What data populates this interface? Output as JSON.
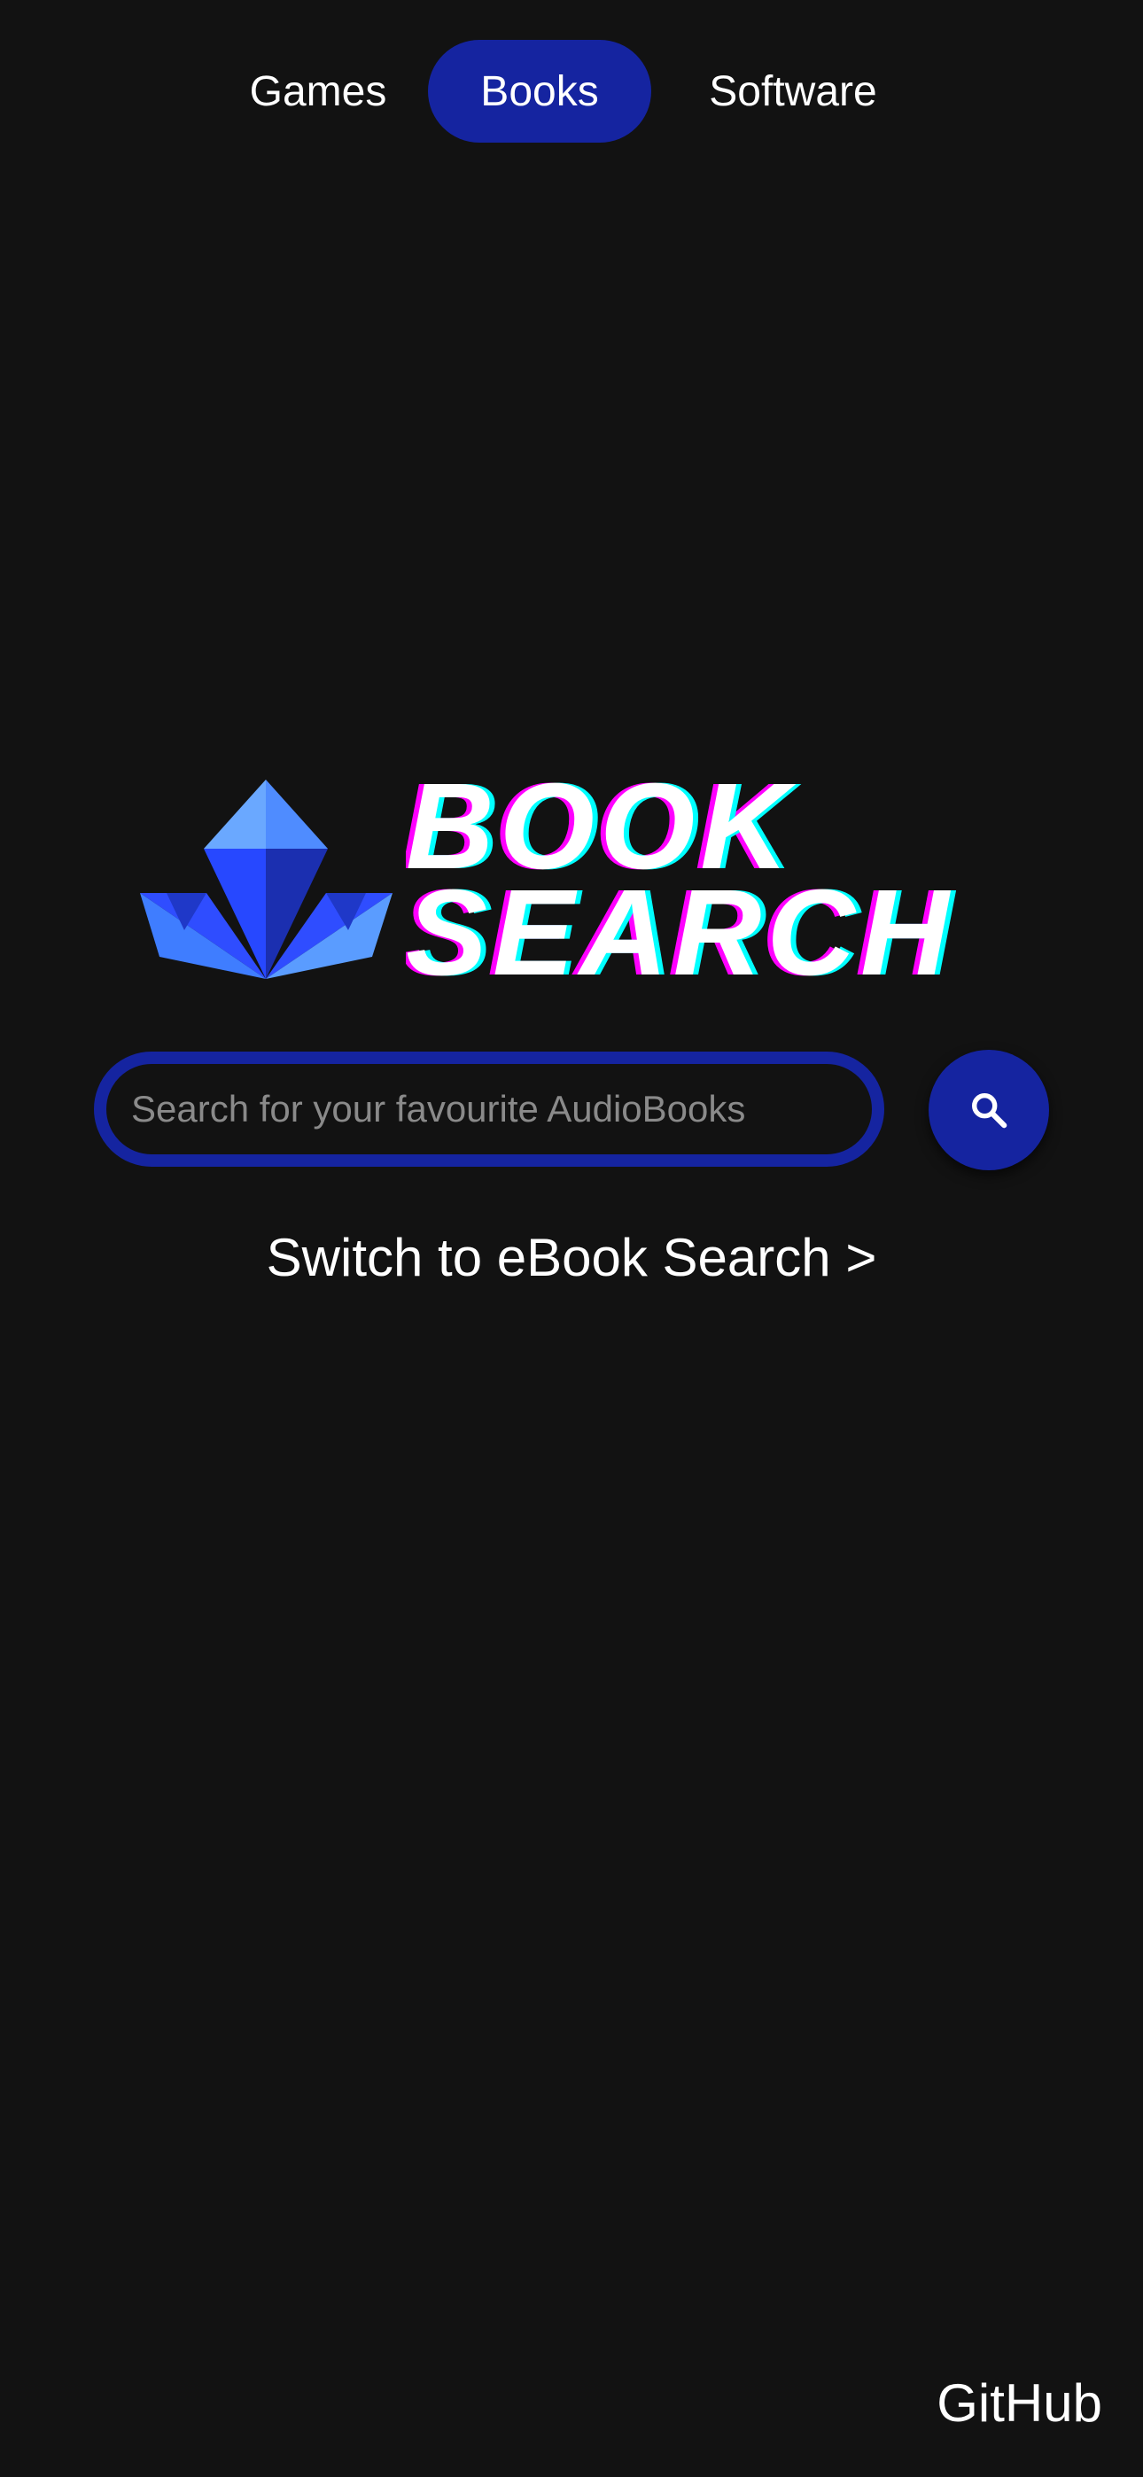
{
  "nav": {
    "tabs": [
      {
        "label": "Games",
        "active": false
      },
      {
        "label": "Books",
        "active": true
      },
      {
        "label": "Software",
        "active": false
      }
    ]
  },
  "logo": {
    "line1": "BOOK",
    "line2": "SEARCH"
  },
  "search": {
    "placeholder": "Search for your favourite AudioBooks",
    "value": "",
    "button_icon": "search-icon"
  },
  "switch_link": "Switch to eBook Search >",
  "footer": {
    "github": "GitHub"
  },
  "colors": {
    "background": "#121212",
    "accent": "#1524a0",
    "logo_magenta": "#ff00ff",
    "logo_cyan": "#00ffff",
    "crystal_light": "#4d94ff",
    "crystal_mid": "#2340ff",
    "crystal_dark": "#1a2bb8"
  }
}
